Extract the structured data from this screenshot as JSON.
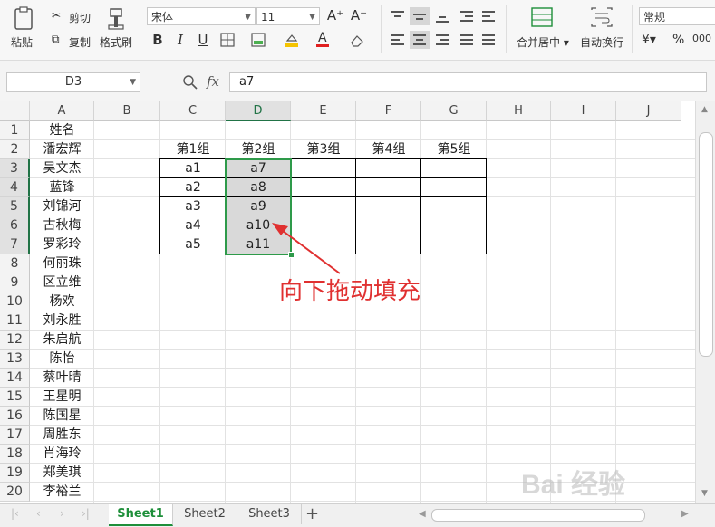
{
  "ribbon": {
    "paste": "粘贴",
    "cut": "剪切",
    "copy": "复制",
    "format_painter": "格式刷",
    "font_name": "宋体",
    "font_size": "11",
    "grow": "A⁺",
    "shrink": "A⁻",
    "bold": "B",
    "italic": "I",
    "underline": "U",
    "font_color_label": "A",
    "merge_center": "合并居中",
    "wrap_text": "自动换行",
    "number_format": "常规",
    "percent": "%",
    "decimal": "000"
  },
  "formula_bar": {
    "name_box": "D3",
    "fx": "fx",
    "value": "a7"
  },
  "columns": [
    "A",
    "B",
    "C",
    "D",
    "E",
    "F",
    "G",
    "H",
    "I",
    "J"
  ],
  "selected_column": "D",
  "rows": [
    "1",
    "2",
    "3",
    "4",
    "5",
    "6",
    "7",
    "8",
    "9",
    "10",
    "11",
    "12",
    "13",
    "14",
    "15",
    "16",
    "17",
    "18",
    "19",
    "20"
  ],
  "column_a": [
    "姓名",
    "潘宏辉",
    "吴文杰",
    "蓝锋",
    "刘锦河",
    "古秋梅",
    "罗彩玲",
    "何丽珠",
    "区立维",
    "杨欢",
    "刘永胜",
    "朱启航",
    "陈怡",
    "蔡叶晴",
    "王星明",
    "陈国星",
    "周胜东",
    "肖海玲",
    "郑美琪",
    "李裕兰"
  ],
  "group_headers": [
    "第1组",
    "第2组",
    "第3组",
    "第4组",
    "第5组"
  ],
  "group1_values": [
    "a1",
    "a2",
    "a3",
    "a4",
    "a5"
  ],
  "group2_values": [
    "a7",
    "a8",
    "a9",
    "a10",
    "a11"
  ],
  "annotation": "向下拖动填充",
  "sheet_tabs": [
    "Sheet1",
    "Sheet2",
    "Sheet3"
  ],
  "active_sheet": "Sheet1",
  "add_sheet": "+",
  "watermark": "Bai 经验",
  "colors": {
    "accent_green": "#217346",
    "selection_border": "#2e9a4a",
    "annotation_red": "#e03030",
    "fill_gray": "#d9d9d9"
  }
}
